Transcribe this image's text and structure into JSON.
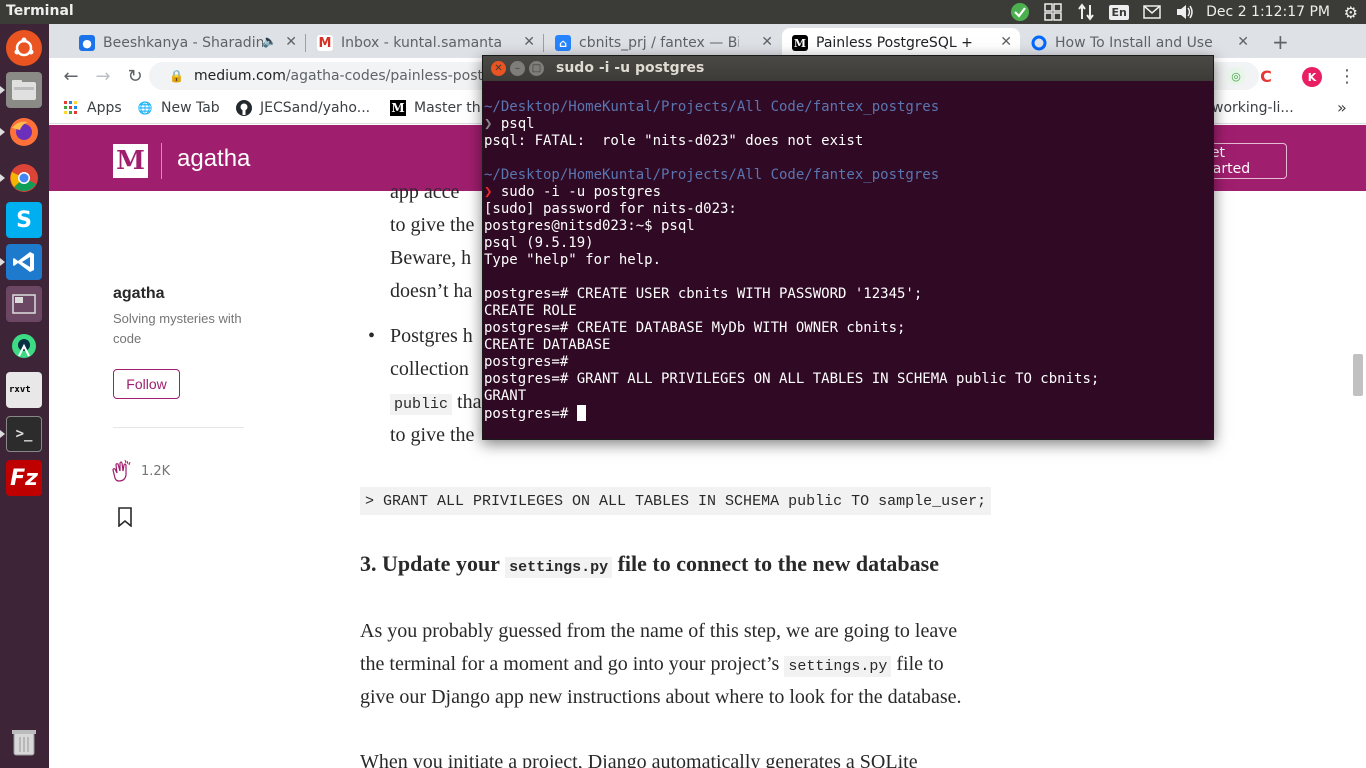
{
  "topbar": {
    "app_name": "Terminal",
    "clock": "Dec 2  1:12:17 PM",
    "keyboard_layout": "En"
  },
  "launcher": {
    "items": [
      "ubuntu-software-icon",
      "files-icon",
      "firefox-icon",
      "chrome-icon",
      "skype-icon",
      "vscode-icon",
      "workspace-switcher-icon",
      "android-studio-icon",
      "rxvt-icon",
      "terminal-icon",
      "filezilla-icon",
      "trash-icon"
    ],
    "rxvt_label": "rxvt"
  },
  "browser": {
    "tabs": [
      {
        "label": "Beeshkanya - Sharadin",
        "favicon_color": "#1a73e8"
      },
      {
        "label": "Inbox - kuntal.samanta@",
        "favicon_color": "#d93025"
      },
      {
        "label": "cbnits_prj / fantex — Bitb",
        "favicon_color": "#2684ff"
      },
      {
        "label": "Painless PostgreSQL + Dja",
        "favicon_color": "#000000"
      },
      {
        "label": "How To Install and Use Po",
        "favicon_color": "#0069ff"
      }
    ],
    "url_host": "medium.com",
    "url_path": "/agatha-codes/painless-postgresql",
    "bookmarks": [
      {
        "label": "Apps"
      },
      {
        "label": "New Tab"
      },
      {
        "label": "JECSand/yaho..."
      },
      {
        "label": "Master th"
      },
      {
        "label": "working-li..."
      }
    ],
    "profile_initial": "K"
  },
  "medium": {
    "logo_letter": "M",
    "publication": "agatha",
    "get_started": "Get started",
    "author_name": "agatha",
    "author_bio": "Solving mysteries with code",
    "follow_label": "Follow",
    "claps": "1.2K"
  },
  "article": {
    "partial_lines": [
      "app acce",
      "to give the",
      "Beware, h",
      "doesn’t ha"
    ],
    "bullet_lines": [
      "Postgres h",
      "collection"
    ],
    "inline_code_public": "public",
    "public_after": " tha",
    "last_bullet_line": "to give the",
    "code_block": "> GRANT ALL PRIVILEGES ON ALL TABLES IN SCHEMA public TO sample_user;",
    "heading_prefix": "3. Update your ",
    "heading_code": "settings.py",
    "heading_suffix": " file to connect to the new database",
    "para1_line1": "As you probably guessed from the name of this step, we are going to leave",
    "para1_line2_pre": "the terminal for a moment and go into your project’s ",
    "para1_line2_code": "settings.py",
    "para1_line2_post": " file to",
    "para1_line3": "give our Django app new instructions about where to look for the database.",
    "para2_line1": "When you initiate a project, Django automatically generates a SQLite"
  },
  "terminal": {
    "title": "sudo -i -u postgres",
    "lines": [
      {
        "kind": "path",
        "text": "~/Desktop/HomeKuntal/Projects/All Code/fantex_postgres"
      },
      {
        "kind": "prompt-ok",
        "prompt": "❯ ",
        "text": "psql"
      },
      {
        "kind": "plain",
        "text": "psql: FATAL:  role \"nits-d023\" does not exist"
      },
      {
        "kind": "plain",
        "text": ""
      },
      {
        "kind": "path",
        "text": "~/Desktop/HomeKuntal/Projects/All Code/fantex_postgres"
      },
      {
        "kind": "prompt-err",
        "prompt": "❯ ",
        "text": "sudo -i -u postgres"
      },
      {
        "kind": "plain",
        "text": "[sudo] password for nits-d023:"
      },
      {
        "kind": "plain",
        "text": "postgres@nitsd023:~$ psql"
      },
      {
        "kind": "plain",
        "text": "psql (9.5.19)"
      },
      {
        "kind": "plain",
        "text": "Type \"help\" for help."
      },
      {
        "kind": "plain",
        "text": ""
      },
      {
        "kind": "plain",
        "text": "postgres=# CREATE USER cbnits WITH PASSWORD '12345';"
      },
      {
        "kind": "plain",
        "text": "CREATE ROLE"
      },
      {
        "kind": "plain",
        "text": "postgres=# CREATE DATABASE MyDb WITH OWNER cbnits;"
      },
      {
        "kind": "plain",
        "text": "CREATE DATABASE"
      },
      {
        "kind": "plain",
        "text": "postgres=#"
      },
      {
        "kind": "plain",
        "text": "postgres=# GRANT ALL PRIVILEGES ON ALL TABLES IN SCHEMA public TO cbnits;"
      },
      {
        "kind": "plain",
        "text": "GRANT"
      }
    ],
    "current_prompt": "postgres=# "
  },
  "colors": {
    "medium_brand": "#a01e6e",
    "terminal_bg": "#300a24",
    "launcher_bg": "#3d2437",
    "path_blue": "#5a75b0",
    "error_red": "#ef2929"
  }
}
